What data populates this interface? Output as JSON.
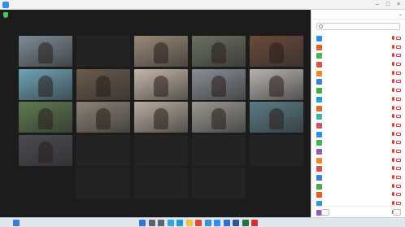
{
  "app": {
    "title": ""
  },
  "meeting": {
    "view_label": ""
  },
  "tiles": [
    {
      "id": "r1c1",
      "video": true,
      "name": "",
      "bg": "#7d8a96"
    },
    {
      "id": "r1c2",
      "video": false,
      "big_name": "",
      "name": ""
    },
    {
      "id": "r1c3",
      "video": true,
      "name": "",
      "bg": "#9a8a78"
    },
    {
      "id": "r1c4",
      "video": true,
      "name": "",
      "bg": "#6a7060"
    },
    {
      "id": "r1c5",
      "video": true,
      "name": "",
      "bg": "#6b4a3a"
    },
    {
      "id": "r2c1",
      "video": true,
      "name": "",
      "bg": "#6fa5b8"
    },
    {
      "id": "r2c2",
      "video": true,
      "name": "",
      "bg": "#6b5a4c"
    },
    {
      "id": "r2c3",
      "video": true,
      "name": "",
      "bg": "#c4b8a8"
    },
    {
      "id": "r2c4",
      "video": true,
      "name": "",
      "bg": "#8a8f94"
    },
    {
      "id": "r2c5",
      "video": true,
      "name": "",
      "bg": "#b7b3b0"
    },
    {
      "id": "r3c1",
      "video": true,
      "name": "",
      "bg": "#5f7a50"
    },
    {
      "id": "r3c2",
      "video": true,
      "name": "",
      "bg": "#8c8276"
    },
    {
      "id": "r3c3",
      "video": true,
      "name": "",
      "bg": "#b8aca0"
    },
    {
      "id": "r3c4",
      "video": true,
      "name": "",
      "bg": "#9a9890"
    },
    {
      "id": "r3c5",
      "video": true,
      "name": "",
      "bg": "#5c7c86"
    },
    {
      "id": "r4c1",
      "video": true,
      "name": "",
      "bg": "#4a4a52"
    },
    {
      "id": "r4c2",
      "video": false,
      "big_name": "",
      "name": ""
    },
    {
      "id": "r4c3",
      "video": false,
      "big_name": "",
      "name": ""
    },
    {
      "id": "r4c4",
      "video": false,
      "big_name": "",
      "name": ""
    },
    {
      "id": "r4c5",
      "video": false,
      "big_name": "",
      "name": ""
    },
    {
      "id": "r5c2",
      "video": false,
      "big_name": "",
      "name": ""
    },
    {
      "id": "r5c3",
      "video": false,
      "big_name": "",
      "name": ""
    },
    {
      "id": "r5c4",
      "video": false,
      "big_name": "",
      "name": ""
    }
  ],
  "participants_panel": {
    "title": "",
    "count": "",
    "search_placeholder": "",
    "invite_label": "",
    "mute_all_label": "",
    "participants": [
      {
        "name": "",
        "avatar_color": "#2d8cff",
        "mic_muted": true,
        "cam_off": true
      },
      {
        "name": "",
        "avatar_color": "#e85d2a",
        "mic_muted": true,
        "cam_off": true
      },
      {
        "name": "",
        "avatar_color": "#44b35a",
        "mic_muted": true,
        "cam_off": true
      },
      {
        "name": "",
        "avatar_color": "#d9534f",
        "mic_muted": true,
        "cam_off": true
      },
      {
        "name": "",
        "avatar_color": "#e8892a",
        "mic_muted": true,
        "cam_off": true
      },
      {
        "name": "",
        "avatar_color": "#3c7fd6",
        "mic_muted": true,
        "cam_off": true
      },
      {
        "name": "",
        "avatar_color": "#4aa84a",
        "mic_muted": true,
        "cam_off": true
      },
      {
        "name": "",
        "avatar_color": "#2a9bd6",
        "mic_muted": true,
        "cam_off": true
      },
      {
        "name": "",
        "avatar_color": "#e86a2a",
        "mic_muted": true,
        "cam_off": true
      },
      {
        "name": "",
        "avatar_color": "#3cb4a0",
        "mic_muted": true,
        "cam_off": true
      },
      {
        "name": "",
        "avatar_color": "#d94f6a",
        "mic_muted": true,
        "cam_off": true
      },
      {
        "name": "",
        "avatar_color": "#2d8cff",
        "mic_muted": true,
        "cam_off": true
      },
      {
        "name": "",
        "avatar_color": "#44b35a",
        "mic_muted": true,
        "cam_off": true
      },
      {
        "name": "",
        "avatar_color": "#9b59b6",
        "mic_muted": true,
        "cam_off": true
      },
      {
        "name": "",
        "avatar_color": "#e8892a",
        "mic_muted": true,
        "cam_off": true
      },
      {
        "name": "",
        "avatar_color": "#d9534f",
        "mic_muted": true,
        "cam_off": true
      },
      {
        "name": "",
        "avatar_color": "#3c7fd6",
        "mic_muted": true,
        "cam_off": true
      },
      {
        "name": "",
        "avatar_color": "#4aa84a",
        "mic_muted": true,
        "cam_off": true
      },
      {
        "name": "",
        "avatar_color": "#e85d2a",
        "mic_muted": true,
        "cam_off": true
      },
      {
        "name": "",
        "avatar_color": "#2a9bd6",
        "mic_muted": true,
        "cam_off": true
      },
      {
        "name": "",
        "avatar_color": "#9b59b6",
        "mic_muted": true,
        "cam_off": true
      }
    ]
  },
  "taskbar": {
    "clock_time": "",
    "clock_date": "",
    "icons": [
      {
        "name": "start-icon",
        "color": "#2b78d8"
      },
      {
        "name": "search-icon",
        "color": "#5a6570"
      },
      {
        "name": "task-view-icon",
        "color": "#5a6570"
      },
      {
        "name": "widgets-icon",
        "color": "#3aa0e0"
      },
      {
        "name": "edge-icon",
        "color": "#1f9ad6"
      },
      {
        "name": "file-explorer-icon",
        "color": "#f0c040"
      },
      {
        "name": "chrome-icon",
        "color": "#e0463a"
      },
      {
        "name": "store-icon",
        "color": "#3b8fd6"
      },
      {
        "name": "zoom-icon",
        "color": "#2d8cff"
      },
      {
        "name": "mail-icon",
        "color": "#2a6fd0"
      },
      {
        "name": "word-icon",
        "color": "#2b579a"
      },
      {
        "name": "excel-icon",
        "color": "#217346"
      },
      {
        "name": "pdf-icon",
        "color": "#d9302f"
      }
    ]
  }
}
